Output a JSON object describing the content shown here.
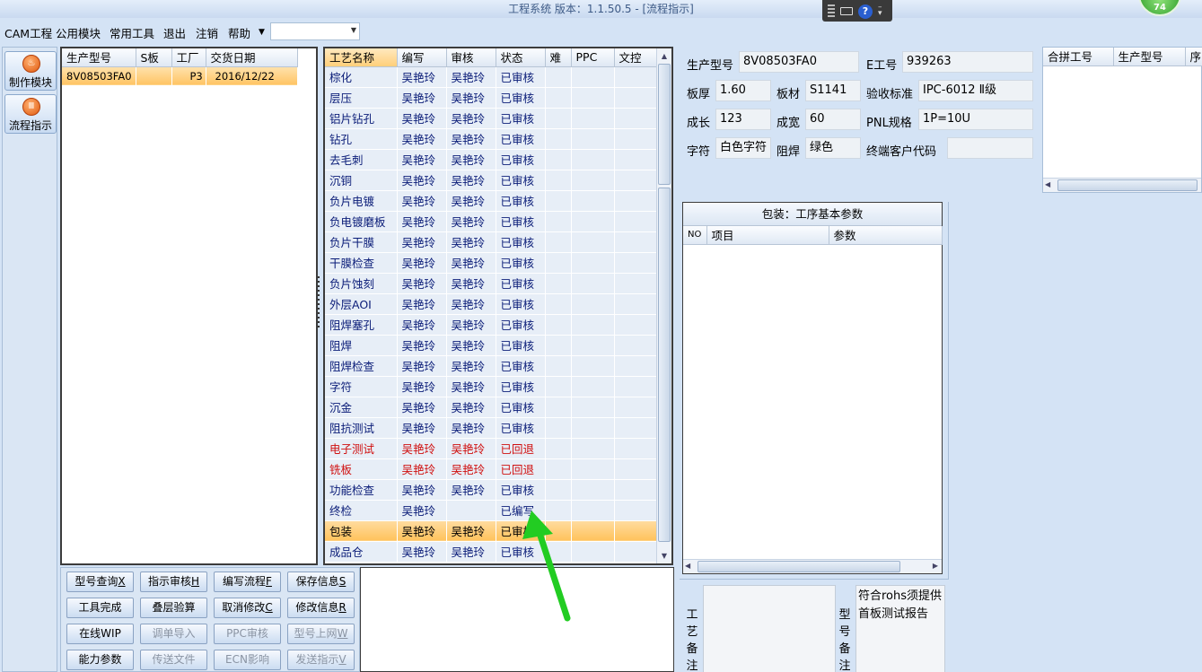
{
  "window": {
    "title": "工程系统   版本：1.1.50.5 - [流程指示]",
    "badge": "74"
  },
  "menu": {
    "items": [
      "CAM工程",
      "公用模块",
      "常用工具",
      "退出",
      "注销",
      "帮助"
    ],
    "combo_value": ""
  },
  "leftnav": {
    "items": [
      {
        "label": "制作模块",
        "icon": "fire-icon"
      },
      {
        "label": "流程指示",
        "icon": "flow-icon"
      }
    ]
  },
  "orders": {
    "columns": [
      "生产型号",
      "S板",
      "工厂",
      "交货日期"
    ],
    "rows": [
      {
        "model": "8V08503FA0",
        "s": "",
        "factory": "P3",
        "date": "2016/12/22"
      }
    ]
  },
  "process": {
    "columns": [
      "工艺名称",
      "编写",
      "审核",
      "状态",
      "难",
      "PPC",
      "文控"
    ],
    "rows": [
      {
        "name": "棕化",
        "writer": "吴艳玲",
        "reviewer": "吴艳玲",
        "status": "已审核"
      },
      {
        "name": "层压",
        "writer": "吴艳玲",
        "reviewer": "吴艳玲",
        "status": "已审核"
      },
      {
        "name": "铝片钻孔",
        "writer": "吴艳玲",
        "reviewer": "吴艳玲",
        "status": "已审核"
      },
      {
        "name": "钻孔",
        "writer": "吴艳玲",
        "reviewer": "吴艳玲",
        "status": "已审核"
      },
      {
        "name": "去毛刺",
        "writer": "吴艳玲",
        "reviewer": "吴艳玲",
        "status": "已审核"
      },
      {
        "name": "沉铜",
        "writer": "吴艳玲",
        "reviewer": "吴艳玲",
        "status": "已审核"
      },
      {
        "name": "负片电镀",
        "writer": "吴艳玲",
        "reviewer": "吴艳玲",
        "status": "已审核"
      },
      {
        "name": "负电镀磨板",
        "writer": "吴艳玲",
        "reviewer": "吴艳玲",
        "status": "已审核"
      },
      {
        "name": "负片干膜",
        "writer": "吴艳玲",
        "reviewer": "吴艳玲",
        "status": "已审核"
      },
      {
        "name": "干膜检查",
        "writer": "吴艳玲",
        "reviewer": "吴艳玲",
        "status": "已审核"
      },
      {
        "name": "负片蚀刻",
        "writer": "吴艳玲",
        "reviewer": "吴艳玲",
        "status": "已审核"
      },
      {
        "name": "外层AOI",
        "writer": "吴艳玲",
        "reviewer": "吴艳玲",
        "status": "已审核"
      },
      {
        "name": "阻焊塞孔",
        "writer": "吴艳玲",
        "reviewer": "吴艳玲",
        "status": "已审核"
      },
      {
        "name": "阻焊",
        "writer": "吴艳玲",
        "reviewer": "吴艳玲",
        "status": "已审核"
      },
      {
        "name": "阻焊检查",
        "writer": "吴艳玲",
        "reviewer": "吴艳玲",
        "status": "已审核"
      },
      {
        "name": "字符",
        "writer": "吴艳玲",
        "reviewer": "吴艳玲",
        "status": "已审核"
      },
      {
        "name": "沉金",
        "writer": "吴艳玲",
        "reviewer": "吴艳玲",
        "status": "已审核"
      },
      {
        "name": "阻抗测试",
        "writer": "吴艳玲",
        "reviewer": "吴艳玲",
        "status": "已审核"
      },
      {
        "name": "电子测试",
        "writer": "吴艳玲",
        "reviewer": "吴艳玲",
        "status": "已回退"
      },
      {
        "name": "铣板",
        "writer": "吴艳玲",
        "reviewer": "吴艳玲",
        "status": "已回退"
      },
      {
        "name": "功能检查",
        "writer": "吴艳玲",
        "reviewer": "吴艳玲",
        "status": "已审核"
      },
      {
        "name": "终检",
        "writer": "吴艳玲",
        "reviewer": "",
        "status": "已编写"
      },
      {
        "name": "包装",
        "writer": "吴艳玲",
        "reviewer": "吴艳玲",
        "status": "已审核"
      },
      {
        "name": "成品仓",
        "writer": "吴艳玲",
        "reviewer": "吴艳玲",
        "status": "已审核"
      }
    ],
    "selected_name": "包装"
  },
  "buttons": [
    {
      "label": "型号查询",
      "key": "X",
      "enabled": true
    },
    {
      "label": "指示审核",
      "key": "H",
      "enabled": true
    },
    {
      "label": "编写流程",
      "key": "F",
      "enabled": true
    },
    {
      "label": "保存信息",
      "key": "S",
      "enabled": true
    },
    {
      "label": "工具完成",
      "key": "",
      "enabled": true
    },
    {
      "label": "叠层验算",
      "key": "",
      "enabled": true
    },
    {
      "label": "取消修改",
      "key": "C",
      "enabled": true
    },
    {
      "label": "修改信息",
      "key": "R",
      "enabled": true
    },
    {
      "label": "在线WIP",
      "key": "",
      "enabled": true
    },
    {
      "label": "调单导入",
      "key": "",
      "enabled": false
    },
    {
      "label": "PPC审核",
      "key": "",
      "enabled": false
    },
    {
      "label": "型号上网",
      "key": "W",
      "enabled": false
    },
    {
      "label": "能力参数",
      "key": "",
      "enabled": true
    },
    {
      "label": "传送文件",
      "key": "",
      "enabled": false
    },
    {
      "label": "ECN影响",
      "key": "",
      "enabled": false
    },
    {
      "label": "发送指示",
      "key": "V",
      "enabled": false
    }
  ],
  "info": {
    "model_label": "生产型号",
    "model_value": "8V08503FA0",
    "e_label": "E工号",
    "e_value": "939263",
    "thickness_label": "板厚",
    "thickness_value": "1.60",
    "material_label": "板材",
    "material_value": "S1141",
    "standard_label": "验收标准",
    "standard_value": "IPC-6012 Ⅱ级",
    "growth_label": "成长",
    "growth_value": "123",
    "width_label": "成宽",
    "width_value": "60",
    "pnl_label": "PNL规格",
    "pnl_value": "1P=10U",
    "char_label": "字符",
    "char_value": "白色字符",
    "mask_label": "阻焊",
    "mask_value": "绿色",
    "customer_code_label": "终端客户代码",
    "customer_code_value": ""
  },
  "merge": {
    "columns": [
      "合拼工号",
      "生产型号",
      "序"
    ]
  },
  "params": {
    "title": "包装：工序基本参数",
    "columns": [
      "NO",
      "项目",
      "参数"
    ]
  },
  "remarks": {
    "process_label": "工艺备注",
    "process_text": "",
    "model_label": "型号备注",
    "model_text": "符合rohs须提供首板测试报告"
  },
  "colors": {
    "selected": "#ffc25c",
    "returned": "#d01010",
    "arrow": "#22cc22"
  }
}
